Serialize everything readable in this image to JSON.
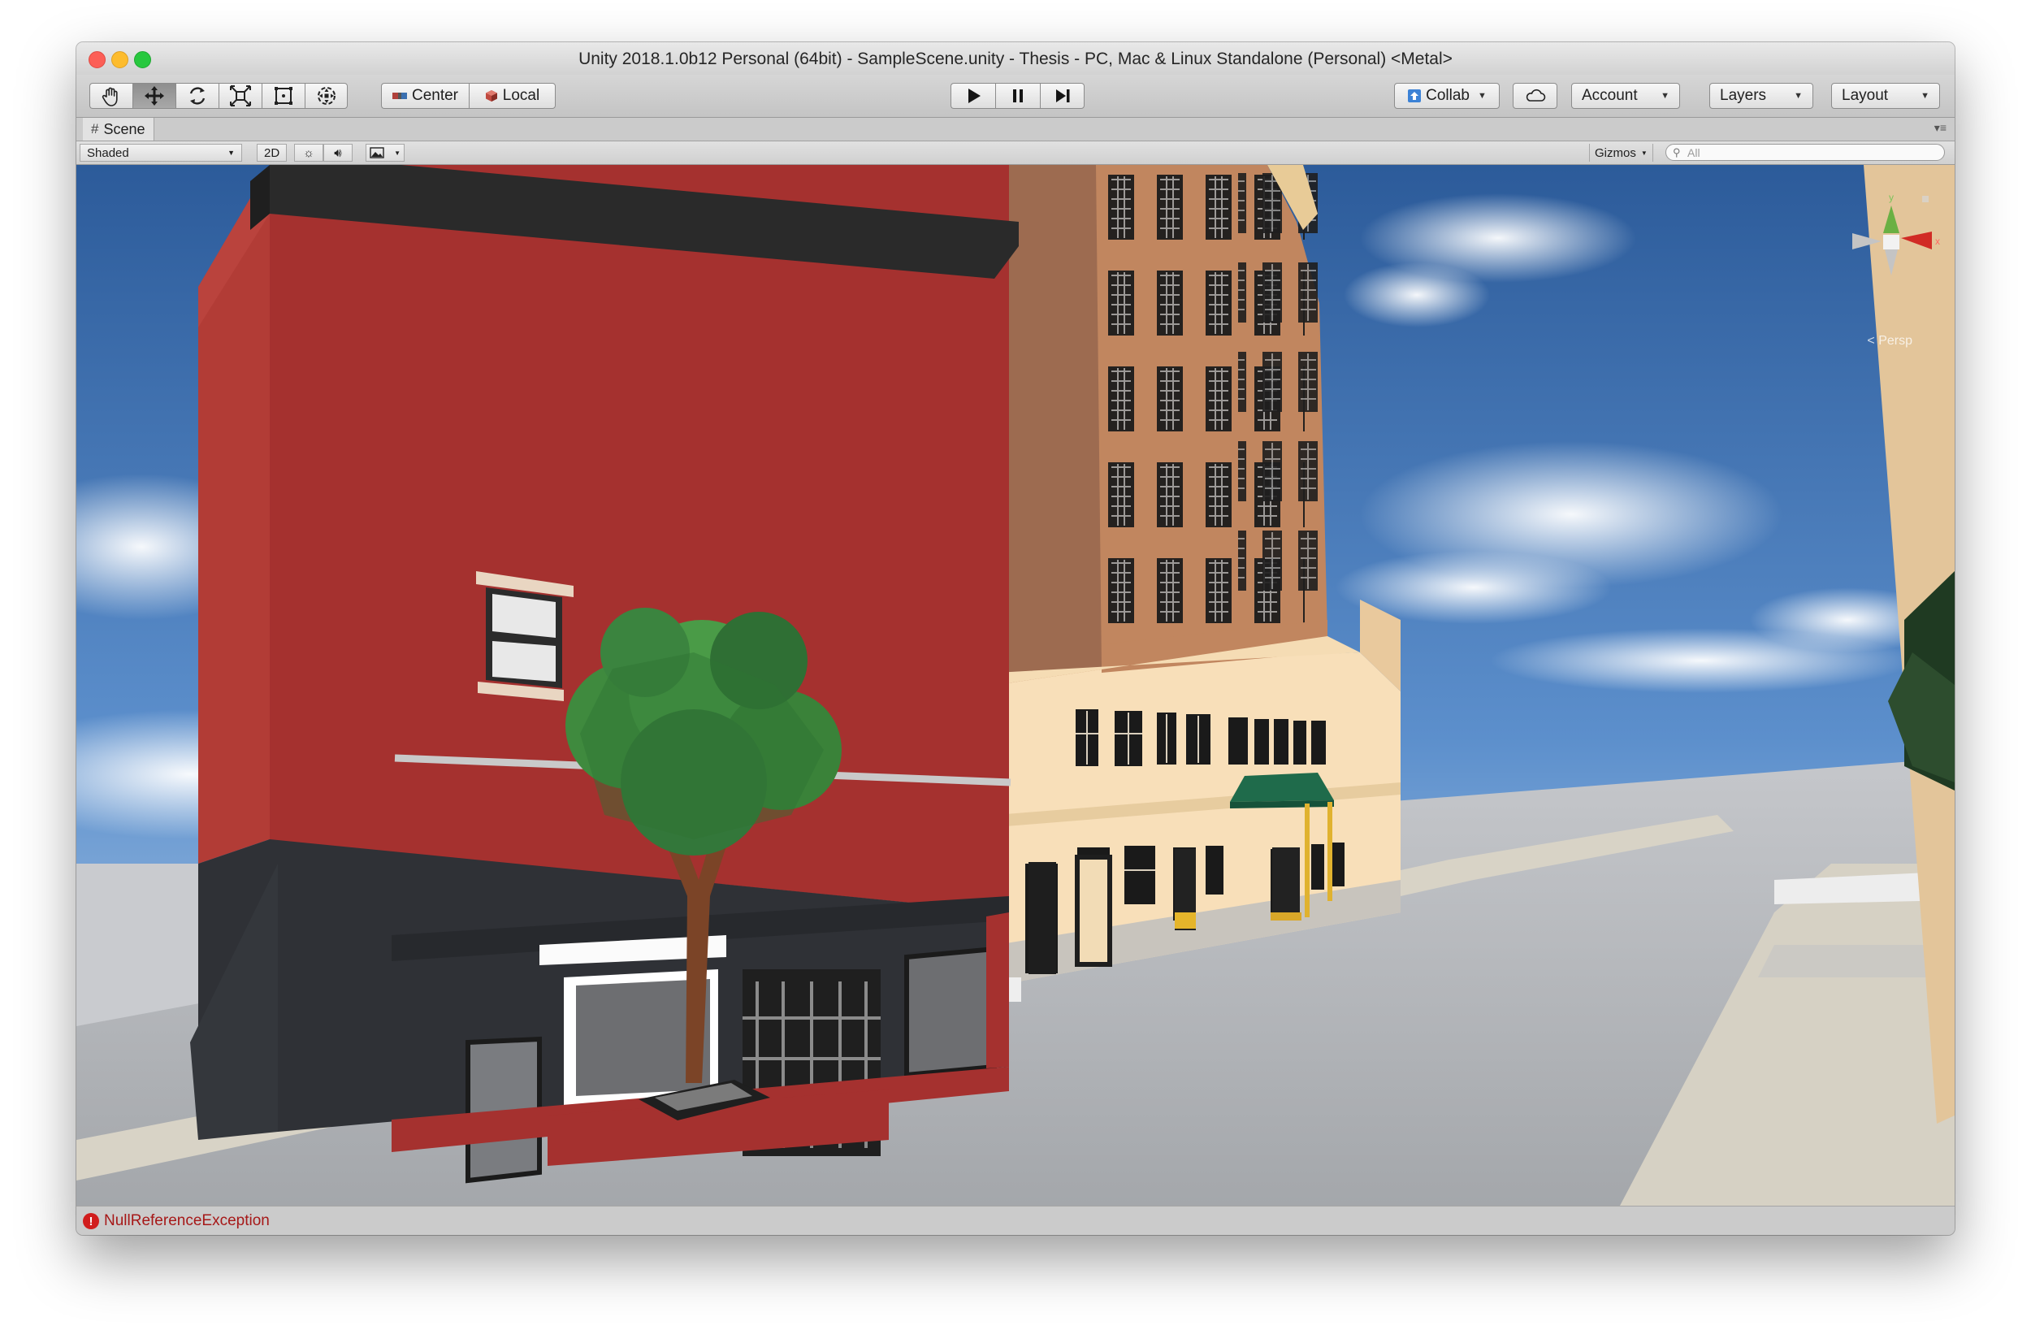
{
  "window": {
    "title": "Unity 2018.1.0b12 Personal (64bit) - SampleScene.unity - Thesis - PC, Mac & Linux Standalone (Personal) <Metal>"
  },
  "toolbar": {
    "tools": [
      "hand-tool",
      "move-tool",
      "rotate-tool",
      "scale-tool",
      "rect-tool",
      "transform-tool"
    ],
    "active_tool": "move-tool",
    "pivot_mode_label": "Center",
    "pivot_rotation_label": "Local",
    "collab_label": "Collab",
    "account_label": "Account",
    "layers_label": "Layers",
    "layout_label": "Layout"
  },
  "scene_view": {
    "tab_label": "Scene",
    "draw_mode": "Shaded",
    "mode_2d_label": "2D",
    "gizmos_label": "Gizmos",
    "search_placeholder": "All",
    "gizmo_axes": {
      "y": "y",
      "x": "x"
    },
    "projection_label": "Persp"
  },
  "status": {
    "message": "NullReferenceException",
    "severity": "error"
  },
  "colors": {
    "sky_top": "#2c5b9a",
    "sky_bottom": "#9cc0e4",
    "red_building": "#a5312f",
    "tower": "#c1865f",
    "cream_building": "#f8dfb9",
    "awning": "#1f6b4b",
    "tree_foliage": "#3f8a3e",
    "street": "#b7b9bd",
    "sidewalk": "#d9d4c8",
    "error_text": "#a61818"
  }
}
